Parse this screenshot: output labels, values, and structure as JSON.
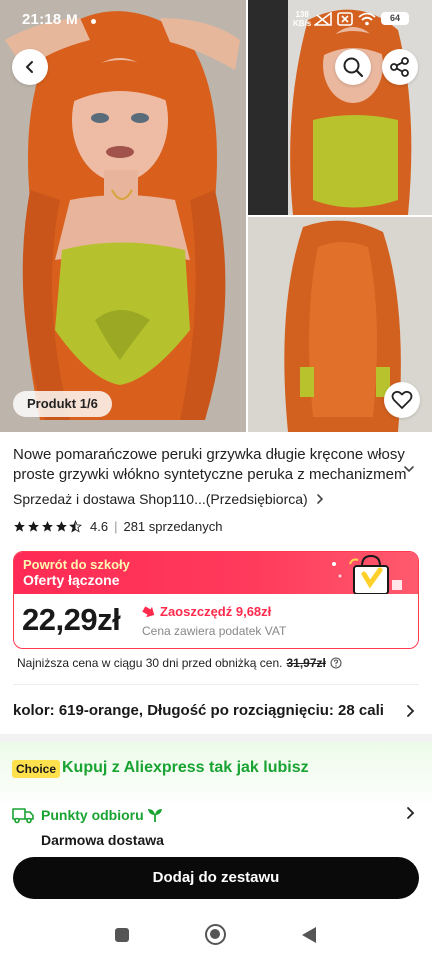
{
  "status_bar": {
    "time": "21:18",
    "mail_glyph": "M",
    "speed_value": "138",
    "speed_unit": "KB/s",
    "battery": "64"
  },
  "gallery": {
    "product_counter": "Produkt 1/6",
    "main_image_icon": "wig-model-front-photo",
    "side_image_top_icon": "wig-model-side-photo",
    "side_image_bottom_icon": "wig-model-back-photo"
  },
  "product": {
    "title": "Nowe pomarańczowe peruki grzywka długie kręcone włosy proste grzywki włókno syntetyczne peruka z mechanizmem",
    "seller": "Sprzedaż i dostawa Shop110...(Przedsiębiorca)",
    "rating": "4.6",
    "sold": "281 sprzedanych",
    "stars_filled": 4.5
  },
  "promo": {
    "line1": "Powrót do szkoły",
    "line2": "Oferty łączone"
  },
  "price": {
    "current": "22,29zł",
    "savings": "Zaoszczędź 9,68zł",
    "vat_note": "Cena zawiera podatek VAT",
    "lowest_label": "Najniższa cena w ciągu 30 dni przed obniżką cen.",
    "lowest_value": "31,97zł"
  },
  "variant": {
    "label": "kolor: 619-orange, Długość po rozciągnięciu: 28 cali"
  },
  "choice": {
    "badge": "Choice",
    "tagline": "Kupuj z Aliexpress tak jak lubisz",
    "pickup": "Punkty odbioru",
    "free_delivery": "Darmowa dostawa"
  },
  "actions": {
    "add_to_set": "Dodaj do zestawu"
  },
  "colors": {
    "accent_red": "#ff2a4c",
    "choice_green": "#19a332",
    "choice_yellow": "#ffe14d",
    "button_black": "#0a0a0a"
  }
}
